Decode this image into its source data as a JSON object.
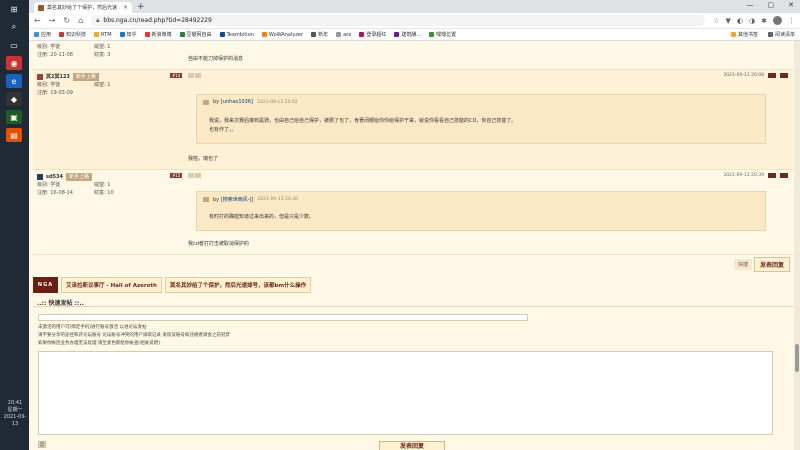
{
  "taskbar": {
    "clock_time": "20:41",
    "clock_date": "2021-09-13",
    "clock_extra": "星期一"
  },
  "browser": {
    "tab_title": "莫名其妙给了个保护，然后光速",
    "url": "bbs.nga.cn/read.php?tid=28492229",
    "bookmarks": [
      "应用",
      "知识科技",
      "RTM",
      "知乎",
      "新浪微博",
      "豆瓣网自由",
      "Teambition",
      "WoWAnalyzer",
      "新年",
      "ass",
      "登录超红",
      "建筑酬...",
      "嘿嘿位置"
    ],
    "bookmarks_right": [
      "其他书签",
      "阅读清单"
    ]
  },
  "posts": [
    {
      "label_level": "级别:",
      "level": "学徒",
      "label_rank": "威望:",
      "rank": "1",
      "label_reg": "注册:",
      "reg": "20-11-08",
      "label_money": "财富:",
      "money": "3",
      "content": "自由不能刀掉保护的消息"
    },
    {
      "username": "冥2冥123",
      "badge": "新手上路",
      "floor": "#14",
      "label_level": "级别:",
      "level": "学徒",
      "label_rank": "威望:",
      "rank": "1",
      "label_reg": "注册:",
      "reg": "19-03-09",
      "date": "2021-09-13 20:08",
      "quote": {
        "user": "unhao1036",
        "time": "2021-09-13 20:02",
        "lines": [
          "我说，我来次赛后接到黑骑，也由自己给自己保护，被那了也了，肯著闭眼给你你给保护于来，就说你看看自己技能的CD，你自己技能了。",
          "也有作了，。"
        ]
      },
      "reply": "我啦，瑞也了"
    },
    {
      "username": "sd534",
      "badge": "新手上路",
      "floor": "#15",
      "label_level": "级别:",
      "level": "学徒",
      "label_rank": "威望:",
      "rank": "1",
      "label_reg": "注册:",
      "reg": "16-08-14",
      "label_money": "财富:",
      "money": "10",
      "date": "2021-09-13 20:39",
      "quote": {
        "user": "搜索世西风-]",
        "time": "2021-09-13 20:30",
        "lines": [
          "有时打的确能知道过来出来的，但是只是少数。"
        ]
      },
      "reply": "我cd者打打击被取消保护的"
    }
  ],
  "reply": {
    "hint": "快捷",
    "button": "发表回复"
  },
  "breadcrumbs": {
    "logo": "NGA",
    "forum": "艾泽拉斯议事厅 - Hall of Azeroth",
    "thread": "莫名其妙给了个保护，然后光速掉号，该都bm什么操作"
  },
  "quickpost": {
    "title": "..:: 快速发帖 ::..",
    "notices": [
      "未激活的用户可[绑定手机]进行账号激活 以进论坛发帖",
      "请不要分享的途径和开论坛账号 论坛帐号冲突的用户请取记录 发现该账号如违规者请会之前封禁",
      "如果你帐因业务办理无法处理 请至爱色斯给你帐查[相关说明]"
    ],
    "submit": "发表回复(Ctrl+Enter)"
  }
}
